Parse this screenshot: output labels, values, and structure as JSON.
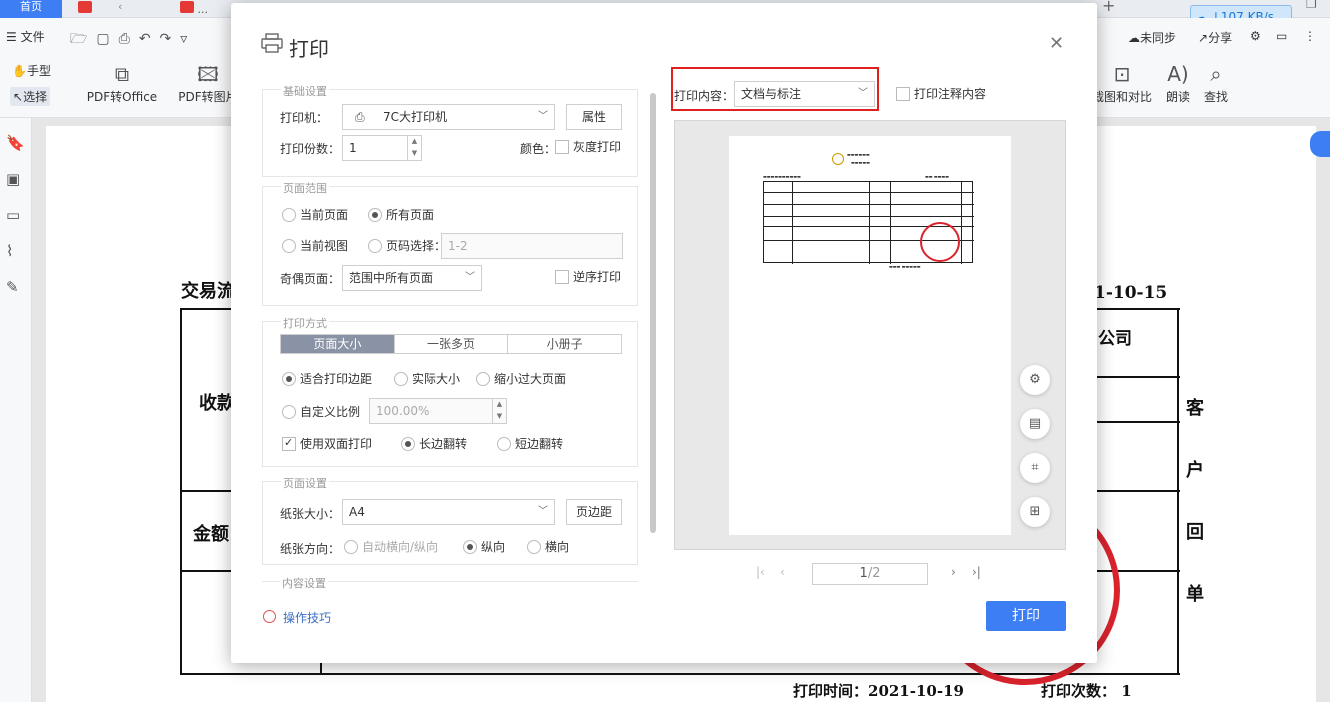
{
  "app": {
    "tab_home": "首页",
    "tab_doc_suffix": "...",
    "speed": "107 KB/s",
    "menu_file": "文件",
    "sync": "未同步",
    "share": "分享",
    "ribbon": {
      "hand": "手型",
      "select": "选择",
      "pdf_to_office": "PDF转Office",
      "pdf_to_image": "PDF转图片",
      "crop_compare": "截图和对比",
      "read_aloud": "朗读",
      "find": "查找"
    }
  },
  "document": {
    "tx_label": "交易流",
    "date_fragment": "1-10-15",
    "company_fragment": "公司",
    "payee_fragment": "收款",
    "amount_fragment": "金额",
    "side_chars": [
      "客",
      "户",
      "回",
      "单"
    ],
    "print_time": "打印时间：2021-10-19",
    "print_count": "打印次数：  1"
  },
  "dialog": {
    "title": "打印",
    "basic": {
      "section_title": "基础设置",
      "printer_label": "打印机：",
      "printer_value": "7C大打印机",
      "properties_button": "属性",
      "copies_label": "打印份数：",
      "copies_value": "1",
      "color_label": "颜色：",
      "grayscale": "灰度打印"
    },
    "range": {
      "section_title": "页面范围",
      "current_page": "当前页面",
      "all_pages": "所有页面",
      "current_view": "当前视图",
      "page_select": "页码选择：",
      "page_select_placeholder": "1-2",
      "odd_even_label": "奇偶页面：",
      "odd_even_value": "范围中所有页面",
      "reverse": "逆序打印"
    },
    "method": {
      "section_title": "打印方式",
      "tabs": [
        "页面大小",
        "一张多页",
        "小册子"
      ],
      "fit_margin": "适合打印边距",
      "actual_size": "实际大小",
      "shrink": "缩小过大页面",
      "custom_scale": "自定义比例",
      "custom_scale_value": "100.00%",
      "duplex": "使用双面打印",
      "long_edge": "长边翻转",
      "short_edge": "短边翻转"
    },
    "page_setup": {
      "section_title": "页面设置",
      "paper_label": "纸张大小：",
      "paper_value": "A4",
      "margins_button": "页边距",
      "orientation_label": "纸张方向：",
      "auto": "自动横向/纵向",
      "portrait": "纵向",
      "landscape": "横向"
    },
    "content_section": "内容设置",
    "tips": "操作技巧",
    "print_content_label": "打印内容：",
    "print_content_value": "文档与标注",
    "print_comments": "打印注释内容",
    "pager_current": "1",
    "pager_total": "/2",
    "print_button": "打印"
  }
}
